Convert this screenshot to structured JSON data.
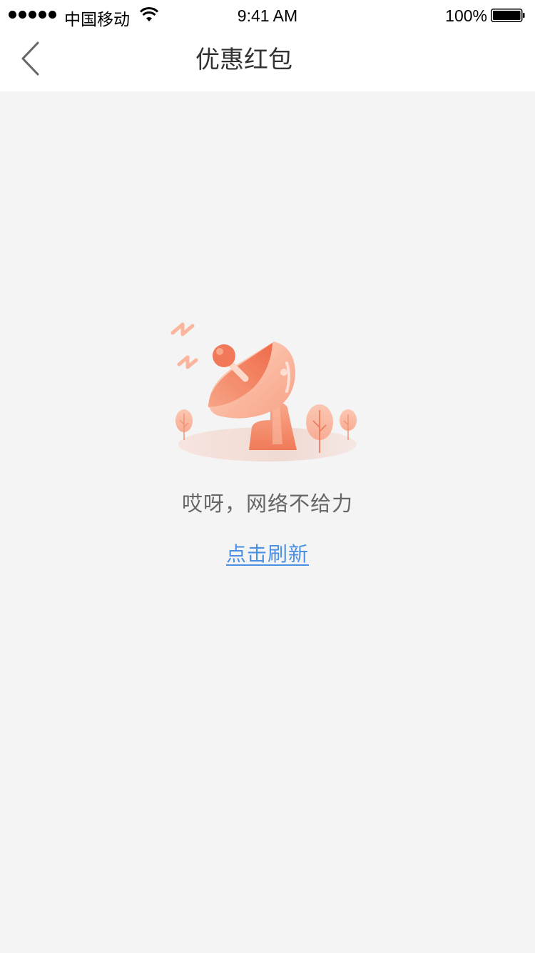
{
  "status_bar": {
    "carrier": "中国移动",
    "time": "9:41 AM",
    "battery": "100%"
  },
  "nav": {
    "title": "优惠红包",
    "back_icon": "chevron-left-icon"
  },
  "empty_state": {
    "illustration": "satellite-dish-icon",
    "message": "哎呀，网络不给力",
    "refresh_label": "点击刷新"
  },
  "colors": {
    "background": "#f4f4f4",
    "link": "#4a90e2",
    "accent": "#f47c5d"
  }
}
